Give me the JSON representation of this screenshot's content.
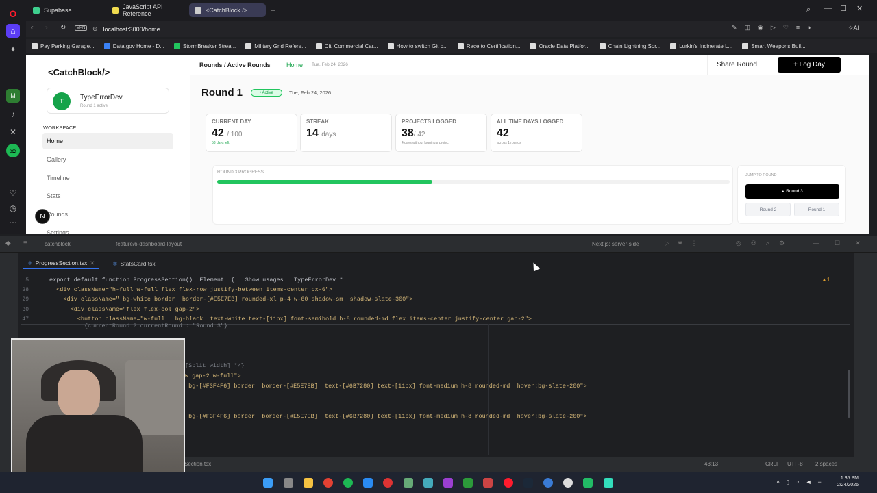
{
  "browser": {
    "tabs": [
      {
        "label": "Supabase"
      },
      {
        "label": "JavaScript API Reference"
      },
      {
        "label": "<CatchBlock />"
      }
    ],
    "url": "localhost:3000/home",
    "vpn_label": "VPN",
    "ai_label": "AI",
    "bookmarks": [
      "Pay Parking Garage...",
      "Data.gov Home - D...",
      "StormBreaker Strea...",
      "Military Grid Refere...",
      "Citi Commercial Car...",
      "How to switch Git b...",
      "Race to Certification...",
      "Oracle Data Platfor...",
      "Chain Lightning Sor...",
      "Lurkin's Incinerate L...",
      "Smart Weapons Buil..."
    ]
  },
  "app": {
    "logo": "<CatchBlock/>",
    "user": {
      "initial": "T",
      "name": "TypeErrorDev",
      "sub": "Round 1 active"
    },
    "workspace_label": "WORKSPACE",
    "nav": [
      "Home",
      "Gallery",
      "Timeline",
      "Stats",
      "Rounds",
      "Settings"
    ],
    "nav_badge": "N",
    "breadcrumb": "Rounds / Active Rounds",
    "breadcrumb_home": "Home",
    "breadcrumb_date": "Tue, Feb 24, 2026",
    "share_label": "Share Round",
    "logday_label": "+ Log Day",
    "round_title": "Round 1",
    "active_badge": "• Active",
    "round_date": "Tue, Feb 24, 2026",
    "stats": [
      {
        "label": "CURRENT DAY",
        "value": "42",
        "unit": "/ 100",
        "sub": "58 days left"
      },
      {
        "label": "STREAK",
        "value": "14",
        "unit": "days",
        "sub": ""
      },
      {
        "label": "PROJECTS LOGGED",
        "value": "38",
        "unit": "/ 42",
        "sub": "4 days without logging a project"
      },
      {
        "label": "ALL TIME DAYS LOGGED",
        "value": "42",
        "unit": "",
        "sub": "across 1 rounds"
      }
    ],
    "progress_label": "ROUND 3 PROGRESS",
    "progress_fraction": 0.42,
    "jump_label": "JUMP TO ROUND",
    "jump_active": "Round 3",
    "jump_options": [
      "Round 2",
      "Round 1"
    ]
  },
  "ide": {
    "project": "catchblock",
    "branch": "feature/6-dashboard-layout",
    "run_config": "Next.js: server-side",
    "tabs": [
      "ProgressSection.tsx",
      "StatsCard.tsx"
    ],
    "status": {
      "position": "43:13",
      "line_ending": "CRLF",
      "encoding": "UTF-8",
      "indent": "2 spaces",
      "file": "Section.tsx"
    },
    "warning_count": "1",
    "lines": [
      {
        "num": "5",
        "text": "export default function ProgressSection()  Element  {   Show usages   TypeErrorDev *"
      },
      {
        "num": "28",
        "text": "  <div className=\"h-full w-full flex flex-row justify-between items-center px-6\">"
      },
      {
        "num": "29",
        "text": "    <div className=\" bg-white border  border-[#E5E7EB] rounded-xl p-4 w-60 shadow-sm  shadow-slate-300\">"
      },
      {
        "num": "30",
        "text": "      <div className=\"flex flex-col gap-2\">"
      },
      {
        "num": "47",
        "text": "        <button className=\"w-full   bg-black  text-white text-[11px] font-semibold h-8 rounded-md flex items-center justify-center gap-2\">"
      }
    ],
    "lower_lines": [
      "          {currentRound ? currentRound : \"Round 3\"}",
      "[Split width] */}",
      "w gap-2 w-full\">",
      " bg-[#F3F4F6] border  border-[#E5E7EB]  text-[#6B7280] text-[11px] font-medium h-8 rounded-md  hover:bg-slate-200\">",
      " bg-[#F3F4F6] border  border-[#E5E7EB]  text-[#6B7280] text-[11px] font-medium h-8 rounded-md  hover:bg-slate-200\">"
    ]
  },
  "taskbar": {
    "time": "1:35 PM",
    "date": "2/24/2026"
  }
}
